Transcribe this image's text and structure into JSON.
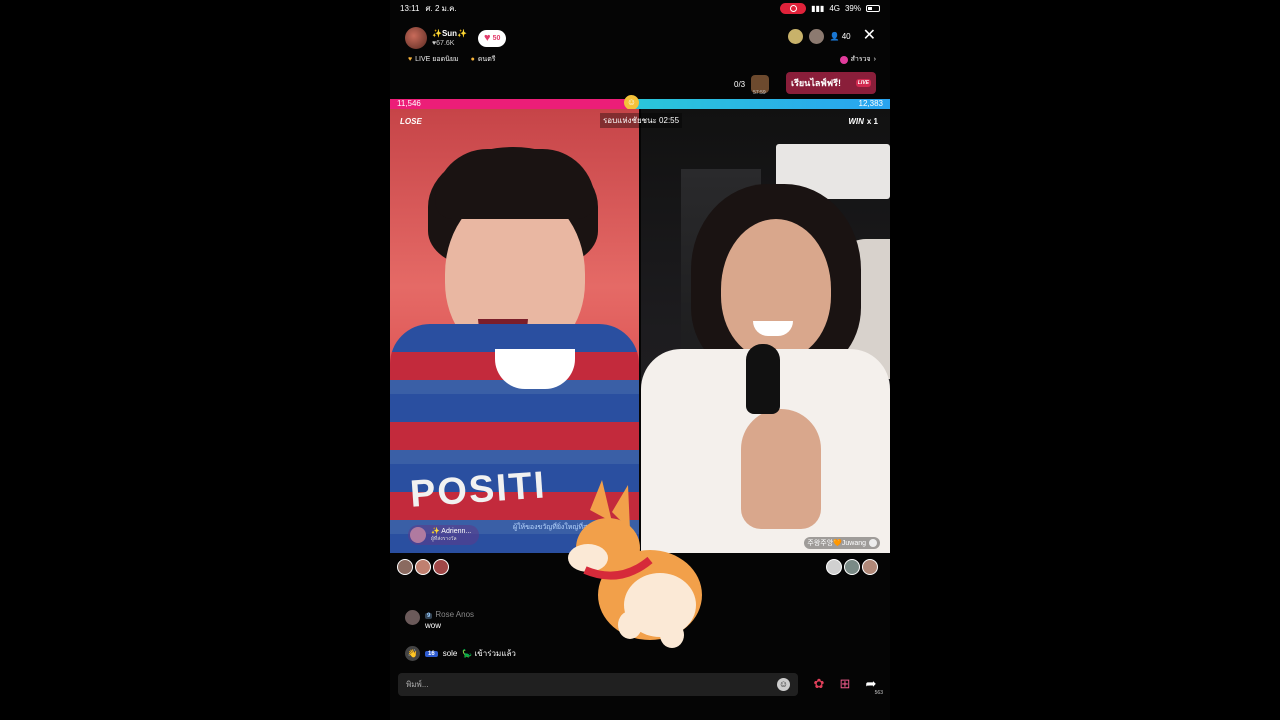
{
  "status_bar": {
    "time": "13:11",
    "date": "ศ. 2 ม.ค.",
    "network": "4G",
    "battery": "39%"
  },
  "host": {
    "name": "✨Sun✨",
    "followers": "67.6K",
    "badge_count": "50"
  },
  "tags": [
    {
      "label": "LIVE ยอดนิยม"
    },
    {
      "label": "ดนตรี"
    }
  ],
  "top_right": {
    "viewer_count": "40",
    "explore_label": "สำรวจ"
  },
  "goal": {
    "progress": "0/3",
    "gift_timer": "57:59"
  },
  "banner": {
    "text": "เรียนไลฟ์ฟรี!",
    "logo": "LIVE"
  },
  "battle": {
    "left_score": "11,546",
    "right_score": "12,383",
    "left_share": 0.483,
    "left_result": "LOSE",
    "right_result": "WIN",
    "right_multiplier": "x 1",
    "round_label": "รอบแห่งชัยชนะ 02:55",
    "left_color": "#ec1e78",
    "right_color": "#29b8e6"
  },
  "left_overlay": {
    "contributor": "✨ Adrienn...",
    "contributor_sub": "ผู้ที่ส่งรางวัล",
    "promo": "ผู้ให้ของขวัญที่ยิ่งใหญ่ที่สุด"
  },
  "right_overlay": {
    "name": "주왕주앙🧡Juwang"
  },
  "chat": [
    {
      "level": "9",
      "user": "Rose Anos",
      "message": "wow"
    },
    {
      "level": "16",
      "user": "sole",
      "message": "🦕 เข้าร่วมแล้ว"
    }
  ],
  "input": {
    "placeholder": "พิมพ์..."
  },
  "actions": {
    "share_count": "563"
  }
}
